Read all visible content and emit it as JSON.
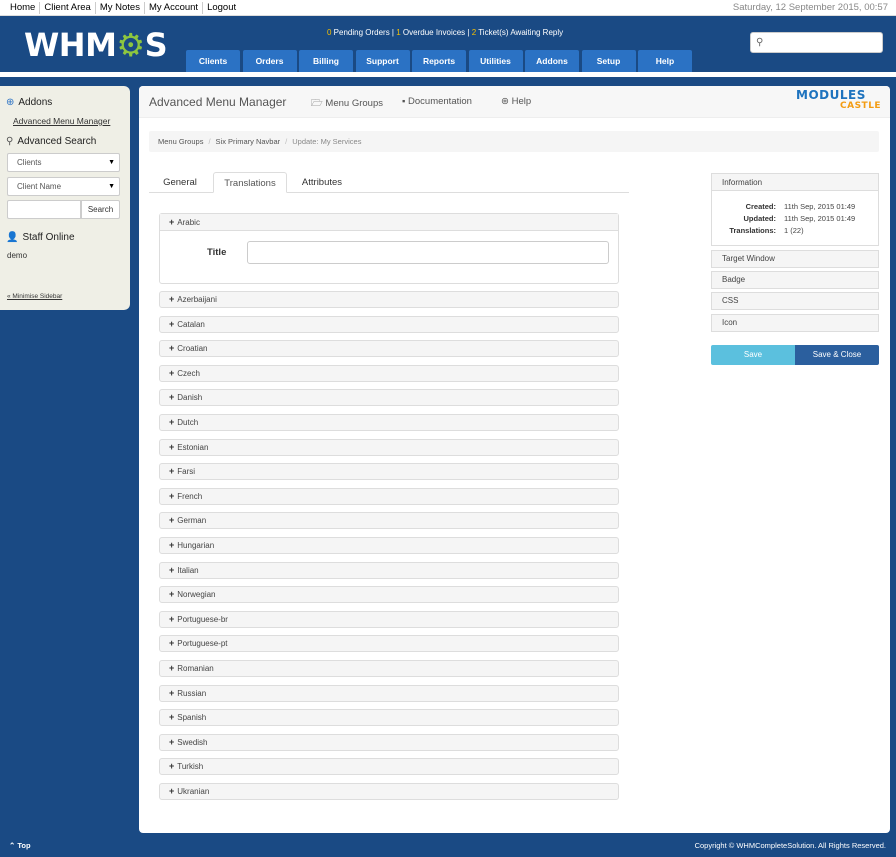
{
  "topbar": {
    "links": [
      "Home",
      "Client Area",
      "My Notes",
      "My Account",
      "Logout"
    ],
    "date": "Saturday, 12 September 2015, 00:57"
  },
  "header": {
    "logo_text": "WHMCS",
    "alerts": {
      "pending_count": "0",
      "pending_label": " Pending Orders | ",
      "overdue_count": "1",
      "overdue_label": " Overdue Invoices | ",
      "tickets_count": "2",
      "tickets_label": " Ticket(s) Awaiting Reply"
    },
    "nav": [
      "Clients",
      "Orders",
      "Billing",
      "Support",
      "Reports",
      "Utilities",
      "Addons",
      "Setup",
      "Help"
    ],
    "search_icon": "search-icon"
  },
  "sidebar": {
    "addons_heading": "Addons",
    "addons_link": "Advanced Menu Manager",
    "search_heading": "Advanced Search",
    "search_type": "Clients",
    "search_field": "Client Name",
    "search_button": "Search",
    "staff_heading": "Staff Online",
    "staff_user": "demo",
    "minimise": "« Minimise Sidebar"
  },
  "page": {
    "title": "Advanced Menu Manager",
    "links": [
      "Menu Groups",
      "Documentation",
      "Help"
    ],
    "brand_top": "MODULES",
    "brand_bottom": "CASTLE",
    "breadcrumb": [
      "Menu Groups",
      "Six Primary Navbar",
      "Update: My Services"
    ],
    "tabs": [
      "General",
      "Translations",
      "Attributes"
    ],
    "active_tab": "Translations",
    "open_language": "Arabic",
    "title_label": "Title",
    "title_value": "",
    "languages": [
      "Azerbaijani",
      "Catalan",
      "Croatian",
      "Czech",
      "Danish",
      "Dutch",
      "Estonian",
      "Farsi",
      "French",
      "German",
      "Hungarian",
      "Italian",
      "Norwegian",
      "Portuguese-br",
      "Portuguese-pt",
      "Romanian",
      "Russian",
      "Spanish",
      "Swedish",
      "Turkish",
      "Ukranian"
    ]
  },
  "info": {
    "heading": "Information",
    "created_label": "Created:",
    "created_value": "11th Sep, 2015 01:49",
    "updated_label": "Updated:",
    "updated_value": "11th Sep, 2015 01:49",
    "translations_label": "Translations:",
    "translations_value": "1 (22)",
    "panels": [
      "Target Window",
      "Badge",
      "CSS",
      "Icon"
    ],
    "save": "Save",
    "save_close": "Save & Close"
  },
  "footer": {
    "top": "Top",
    "copyright": "Copyright © WHMCompleteSolution. All Rights Reserved."
  },
  "colors": {
    "header": "#1a4a84",
    "nav_button": "#2b72c4",
    "accent_green": "#8dc63f",
    "save": "#5bc0de",
    "save_close": "#2b5f9e"
  }
}
